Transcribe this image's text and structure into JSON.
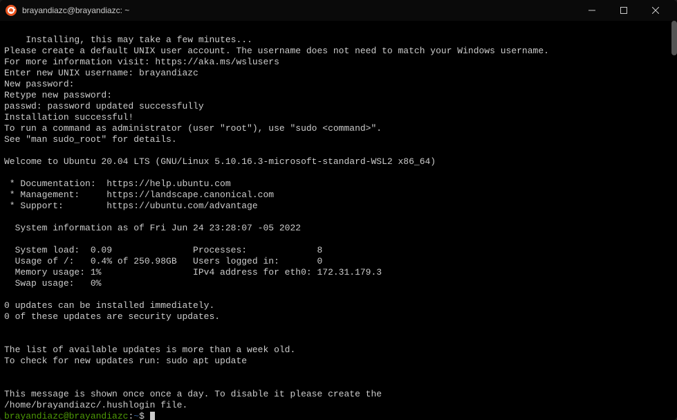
{
  "window": {
    "title": "brayandiazc@brayandiazc: ~"
  },
  "setup": {
    "installing": "Installing, this may take a few minutes...",
    "create_user": "Please create a default UNIX user account. The username does not need to match your Windows username.",
    "more_info": "For more information visit: https://aka.ms/wslusers",
    "enter_username_label": "Enter new UNIX username: ",
    "username_value": "brayandiazc",
    "new_password": "New password:",
    "retype_password": "Retype new password:",
    "passwd_updated": "passwd: password updated successfully",
    "install_success": "Installation successful!",
    "sudo_hint": "To run a command as administrator (user \"root\"), use \"sudo <command>\".",
    "sudo_man": "See \"man sudo_root\" for details."
  },
  "motd": {
    "welcome": "Welcome to Ubuntu 20.04 LTS (GNU/Linux 5.10.16.3-microsoft-standard-WSL2 x86_64)",
    "doc": " * Documentation:  https://help.ubuntu.com",
    "mgmt": " * Management:     https://landscape.canonical.com",
    "support": " * Support:        https://ubuntu.com/advantage",
    "sysinfo_heading": "  System information as of Fri Jun 24 23:28:07 -05 2022",
    "row1": "  System load:  0.09               Processes:             8",
    "row2": "  Usage of /:   0.4% of 250.98GB   Users logged in:       0",
    "row3": "  Memory usage: 1%                 IPv4 address for eth0: 172.31.179.3",
    "row4": "  Swap usage:   0%",
    "updates1": "0 updates can be installed immediately.",
    "updates2": "0 of these updates are security updates.",
    "stale1": "The list of available updates is more than a week old.",
    "stale2": "To check for new updates run: sudo apt update",
    "hush1": "This message is shown once once a day. To disable it please create the",
    "hush2": "/home/brayandiazc/.hushlogin file."
  },
  "prompt": {
    "userhost": "brayandiazc@brayandiazc",
    "colon": ":",
    "path": "~",
    "dollar": "$"
  }
}
